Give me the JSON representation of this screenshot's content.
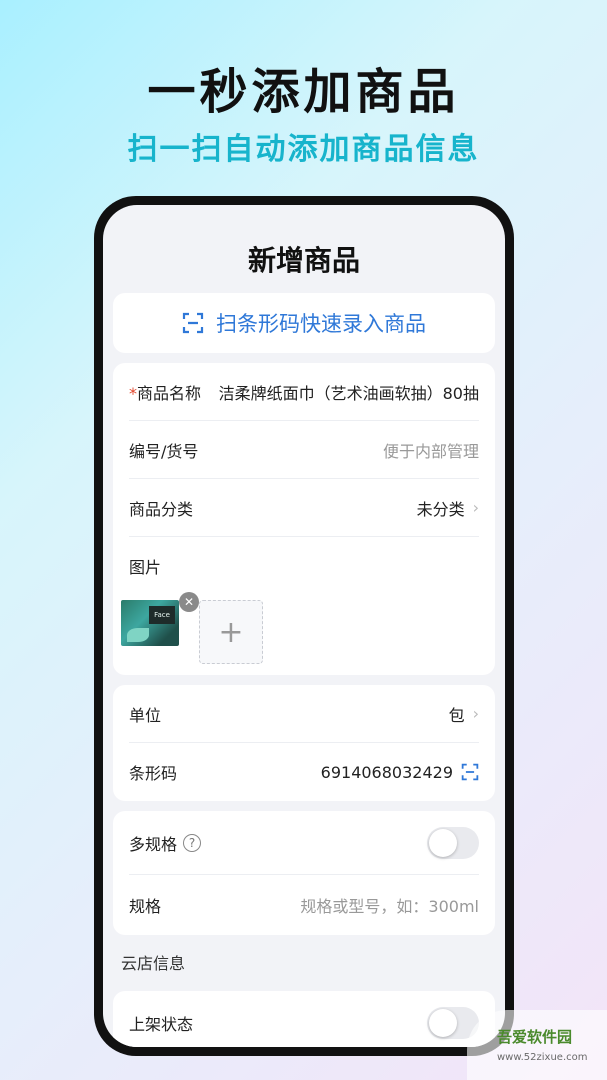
{
  "hero": {
    "title": "一秒添加商品",
    "subtitle": "扫一扫自动添加商品信息"
  },
  "screen": {
    "nav_title": "新增商品",
    "scan_button": "扫条形码快速录入商品",
    "form": {
      "name_required_mark": "*",
      "name_label": "商品名称",
      "name_value": "洁柔牌纸面巾（艺术油画软抽）80抽",
      "code_label": "编号/货号",
      "code_placeholder": "便于内部管理",
      "category_label": "商品分类",
      "category_value": "未分类",
      "image_label": "图片",
      "image_brand": "Face"
    },
    "unit": {
      "unit_label": "单位",
      "unit_value": "包",
      "barcode_label": "条形码",
      "barcode_value": "6914068032429"
    },
    "spec": {
      "multi_spec_label": "多规格",
      "help_glyph": "?",
      "spec_label": "规格",
      "spec_placeholder": "规格或型号，如：300ml"
    },
    "cloud": {
      "section_title": "云店信息",
      "listing_label": "上架状态"
    }
  },
  "watermark": {
    "text": "吾爱软件园",
    "url": "www.52zixue.com"
  },
  "colors": {
    "accent": "#2f78d8",
    "subtitle": "#17b4cc",
    "required": "#e0452b"
  }
}
